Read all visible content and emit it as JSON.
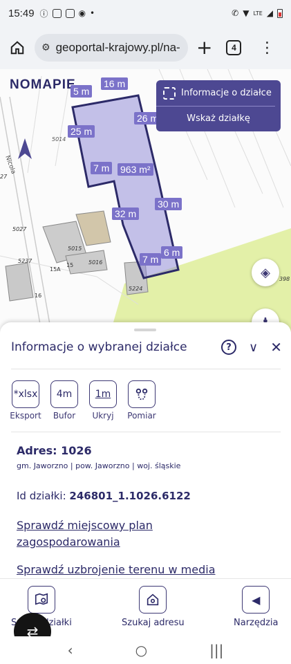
{
  "status_bar": {
    "time": "15:49",
    "left_icons": [
      "info-icon",
      "image-icon",
      "grid-icon",
      "location-icon",
      "dot-icon"
    ],
    "network": "LTE"
  },
  "browser": {
    "url": "geoportal-krajowy.pl/na-",
    "tab_count": "4"
  },
  "map": {
    "logo": "NOMAPIE",
    "info_box": {
      "title": "Informacje o działce",
      "action": "Wskaż działkę"
    },
    "dimensions": [
      "5 m",
      "16 m",
      "26 m",
      "25 m",
      "7 m",
      "963 m²",
      "30 m",
      "32 m",
      "7 m",
      "6 m"
    ],
    "labels": [
      "5014",
      "5015",
      "5016",
      "5027",
      "5237",
      "15A",
      "15",
      "16",
      "5224",
      "398",
      "27",
      "Nicola"
    ],
    "parcel_fill": "#8c86d6",
    "parcel_stroke": "#2c2a68",
    "green_area": "#e3f0a8"
  },
  "sheet": {
    "title": "Informacje o wybranej działce",
    "tools": [
      {
        "icon": "*xlsx",
        "label": "Eksport"
      },
      {
        "icon": "4m",
        "label": "Bufor"
      },
      {
        "icon": "1m",
        "label": "Ukryj"
      },
      {
        "icon": "ruler-icon",
        "label": "Pomiar"
      }
    ],
    "address_label": "Adres: 1026",
    "address_sub": "gm. Jaworzno | pow. Jaworzno | woj. śląskie",
    "id_prefix": "Id działki: ",
    "id_value": "246801_1.1026.6122",
    "link1": "Sprawdź miejscowy plan zagospodarowania",
    "link2": "Sprawdź uzbrojenie terenu w media"
  },
  "bottom_nav": [
    {
      "label": "Szukaj działki",
      "icon": "map-search-icon"
    },
    {
      "label": "Szukaj adresu",
      "icon": "home-search-icon"
    },
    {
      "label": "Narzędzia",
      "icon": "chevron-left-icon"
    }
  ]
}
